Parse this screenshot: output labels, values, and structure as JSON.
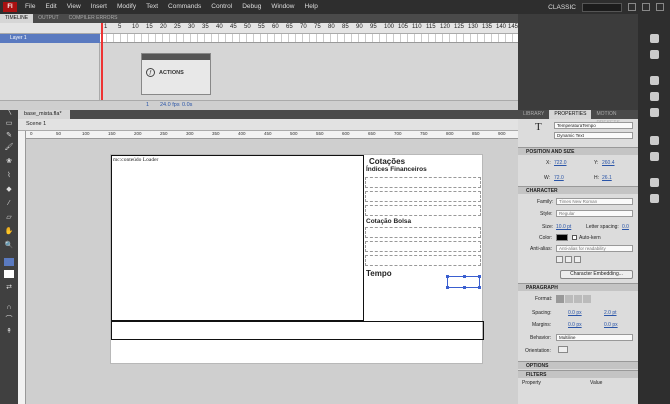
{
  "menu": {
    "logo": "Fl",
    "items": [
      "File",
      "Edit",
      "View",
      "Insert",
      "Modify",
      "Text",
      "Commands",
      "Control",
      "Debug",
      "Window",
      "Help"
    ],
    "workspace": "CLASSIC"
  },
  "timeline": {
    "tabs": [
      "TIMELINE",
      "OUTPUT",
      "COMPILER ERRORS"
    ],
    "frame_numbers": [
      "1",
      "5",
      "10",
      "15",
      "20",
      "25",
      "30",
      "35",
      "40",
      "45",
      "50",
      "55",
      "60",
      "65",
      "70",
      "75",
      "80",
      "85",
      "90",
      "95",
      "100",
      "105",
      "110",
      "115",
      "120",
      "125",
      "130",
      "135",
      "140",
      "145"
    ],
    "layer_name": "Layer 1",
    "footer": {
      "frame": "1",
      "fps": "24.0 fps",
      "time": "0.0s"
    },
    "actions_panel_label": "ACTIONS"
  },
  "document": {
    "tab": "base_mista.fla*",
    "scene": "Scene 1",
    "ruler_ticks": [
      "0",
      "50",
      "100",
      "150",
      "200",
      "250",
      "300",
      "350",
      "400",
      "450",
      "500",
      "550",
      "600",
      "650",
      "700",
      "750",
      "800",
      "850",
      "900"
    ]
  },
  "stage": {
    "loader_label": "mc:conteúdo Loader",
    "cotacoes_title": "Cotações",
    "indices_title": "Índices Financeiros",
    "bolsa_title": "Cotação Bolsa",
    "tempo_title": "Tempo"
  },
  "properties": {
    "tabs": [
      "LIBRARY",
      "PROPERTIES",
      "MOTION PRESETS"
    ],
    "instance_name": "TemperaturaTempo",
    "text_type": "Dynamic Text",
    "position_header": "POSITION AND SIZE",
    "x_label": "X:",
    "x_value": "722.0",
    "y_label": "Y:",
    "y_value": "260.4",
    "w_label": "W:",
    "w_value": "72.0",
    "h_label": "H:",
    "h_value": "26.1",
    "character_header": "CHARACTER",
    "family_label": "Family:",
    "family_value": "Times New Roman",
    "style_label": "Style:",
    "style_value": "Regular",
    "size_label": "Size:",
    "size_value": "10.0 pt",
    "letter_spacing_label": "Letter spacing:",
    "letter_spacing_value": "0.0",
    "color_label": "Color:",
    "auto_kern": "Auto-kern",
    "anti_alias_label": "Anti-alias:",
    "anti_alias_value": "Anti-alias for readability",
    "char_embed_button": "Character Embedding...",
    "paragraph_header": "PARAGRAPH",
    "format_label": "Format:",
    "spacing_label": "Spacing:",
    "spacing_value_1": "0.0 px",
    "spacing_value_2": "2.0 pt",
    "margins_label": "Margins:",
    "margins_value_1": "0.0 px",
    "margins_value_2": "0.0 px",
    "behavior_label": "Behavior:",
    "behavior_value": "Multiline",
    "orientation_label": "Orientation:",
    "options_header": "OPTIONS",
    "filters_header": "FILTERS",
    "filters_col_property": "Property",
    "filters_col_value": "Value"
  }
}
